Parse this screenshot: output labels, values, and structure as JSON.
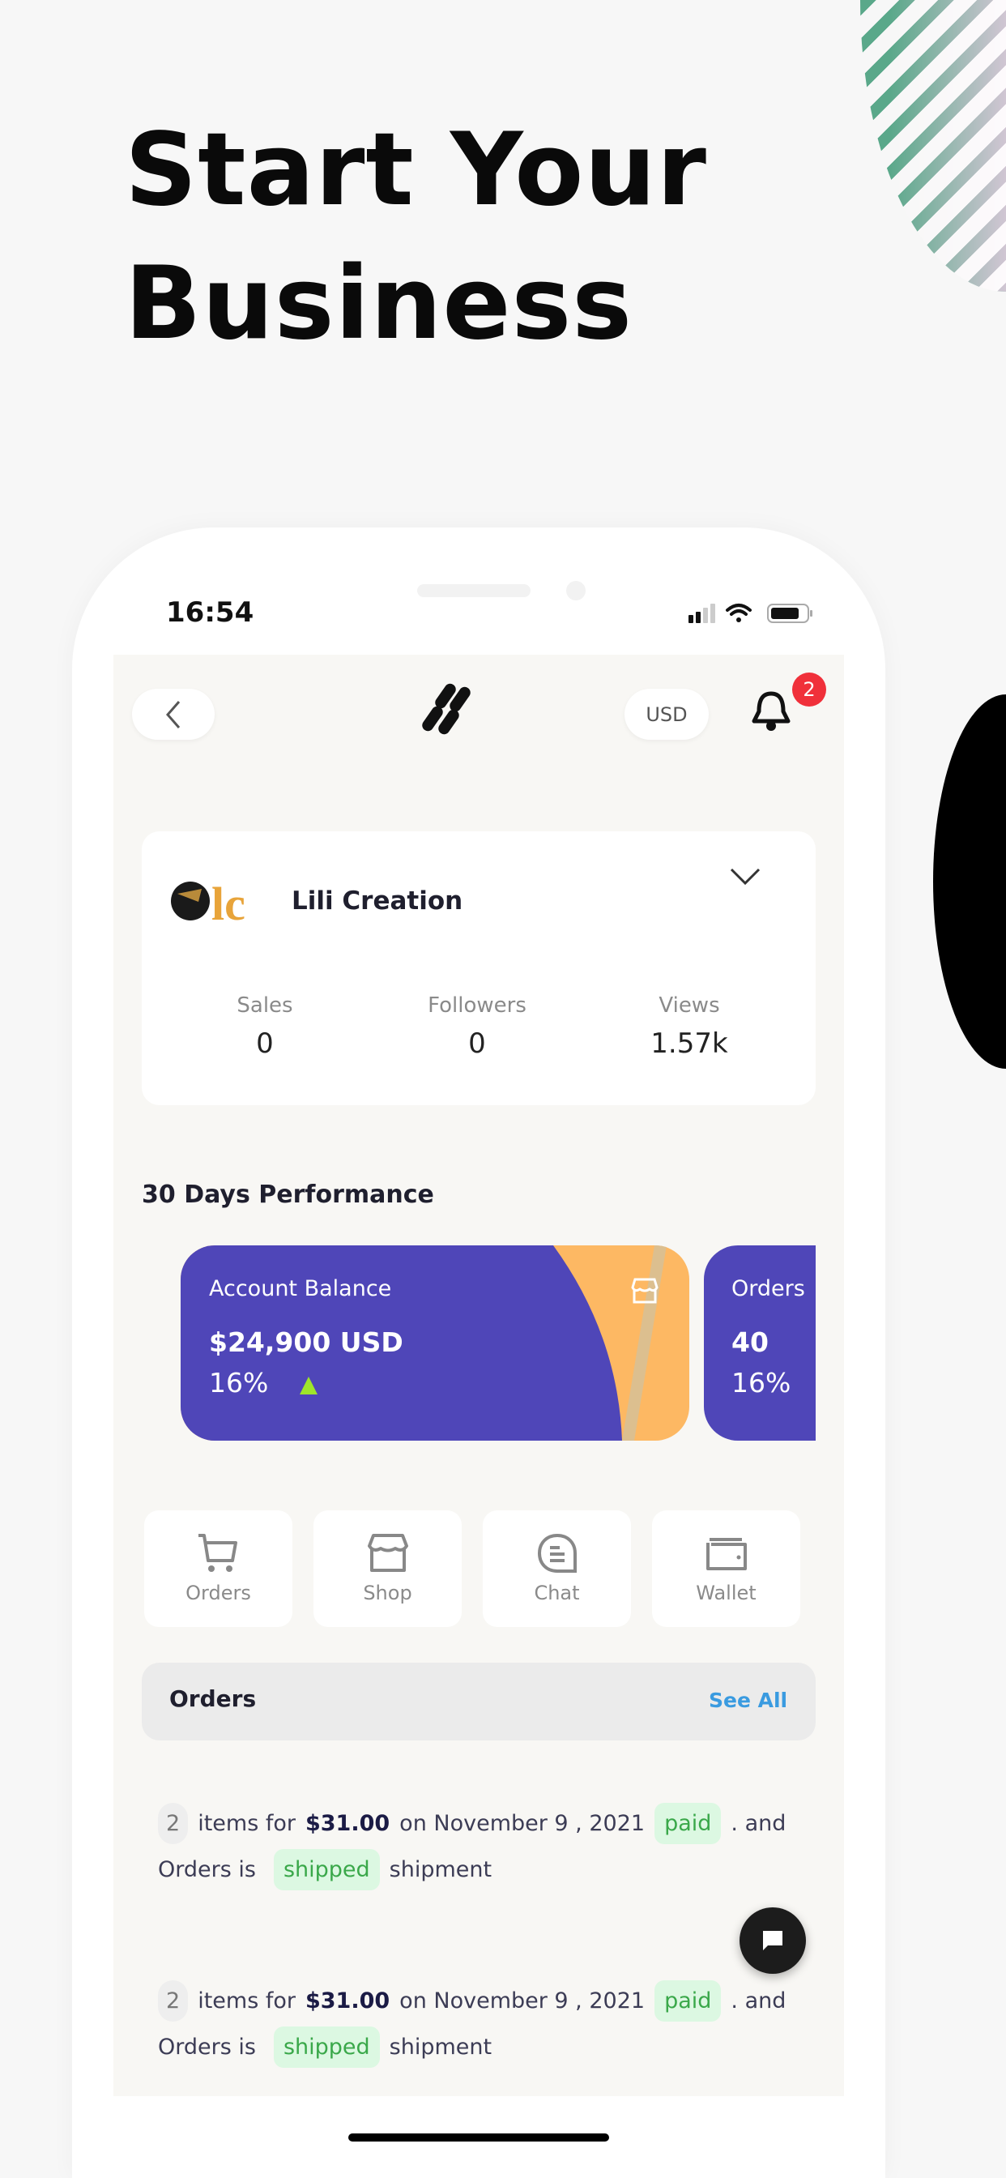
{
  "headline": {
    "line1": "Start Your",
    "line2": "Business"
  },
  "status_bar": {
    "time": "16:54"
  },
  "header": {
    "currency": "USD",
    "notification_count": "2"
  },
  "store": {
    "name": "Lili Creation",
    "stats": [
      {
        "label": "Sales",
        "value": "0"
      },
      {
        "label": "Followers",
        "value": "0"
      },
      {
        "label": "Views",
        "value": "1.57k"
      }
    ]
  },
  "performance": {
    "title": "30 Days Performance",
    "cards": [
      {
        "label": "Account Balance",
        "value": "$24,900 USD",
        "change": "16%",
        "trend": "up"
      },
      {
        "label": "Orders",
        "value": "40",
        "change": "16%"
      }
    ]
  },
  "quick_actions": [
    {
      "label": "Orders",
      "icon": "cart-icon"
    },
    {
      "label": "Shop",
      "icon": "shop-icon"
    },
    {
      "label": "Chat",
      "icon": "chat-icon"
    },
    {
      "label": "Wallet",
      "icon": "wallet-icon"
    }
  ],
  "orders": {
    "title": "Orders",
    "see_all": "See All",
    "items": [
      {
        "count": "2",
        "text1": "items for",
        "amount": "$31.00",
        "text2": "on November 9 , 2021",
        "payment": "paid",
        "text3": ". and",
        "text4": "Orders is",
        "status": "shipped",
        "text5": "shipment"
      },
      {
        "count": "2",
        "text1": "items for",
        "amount": "$31.00",
        "text2": "on November 9 , 2021",
        "payment": "paid",
        "text3": ". and",
        "text4": "Orders is",
        "status": "shipped",
        "text5": "shipment"
      }
    ]
  },
  "colors": {
    "card_purple": "#4f46b8",
    "card_orange": "#fdb863",
    "link_blue": "#3a9be0",
    "badge_red": "#f0303a",
    "tag_green": "#dcf8e2"
  }
}
